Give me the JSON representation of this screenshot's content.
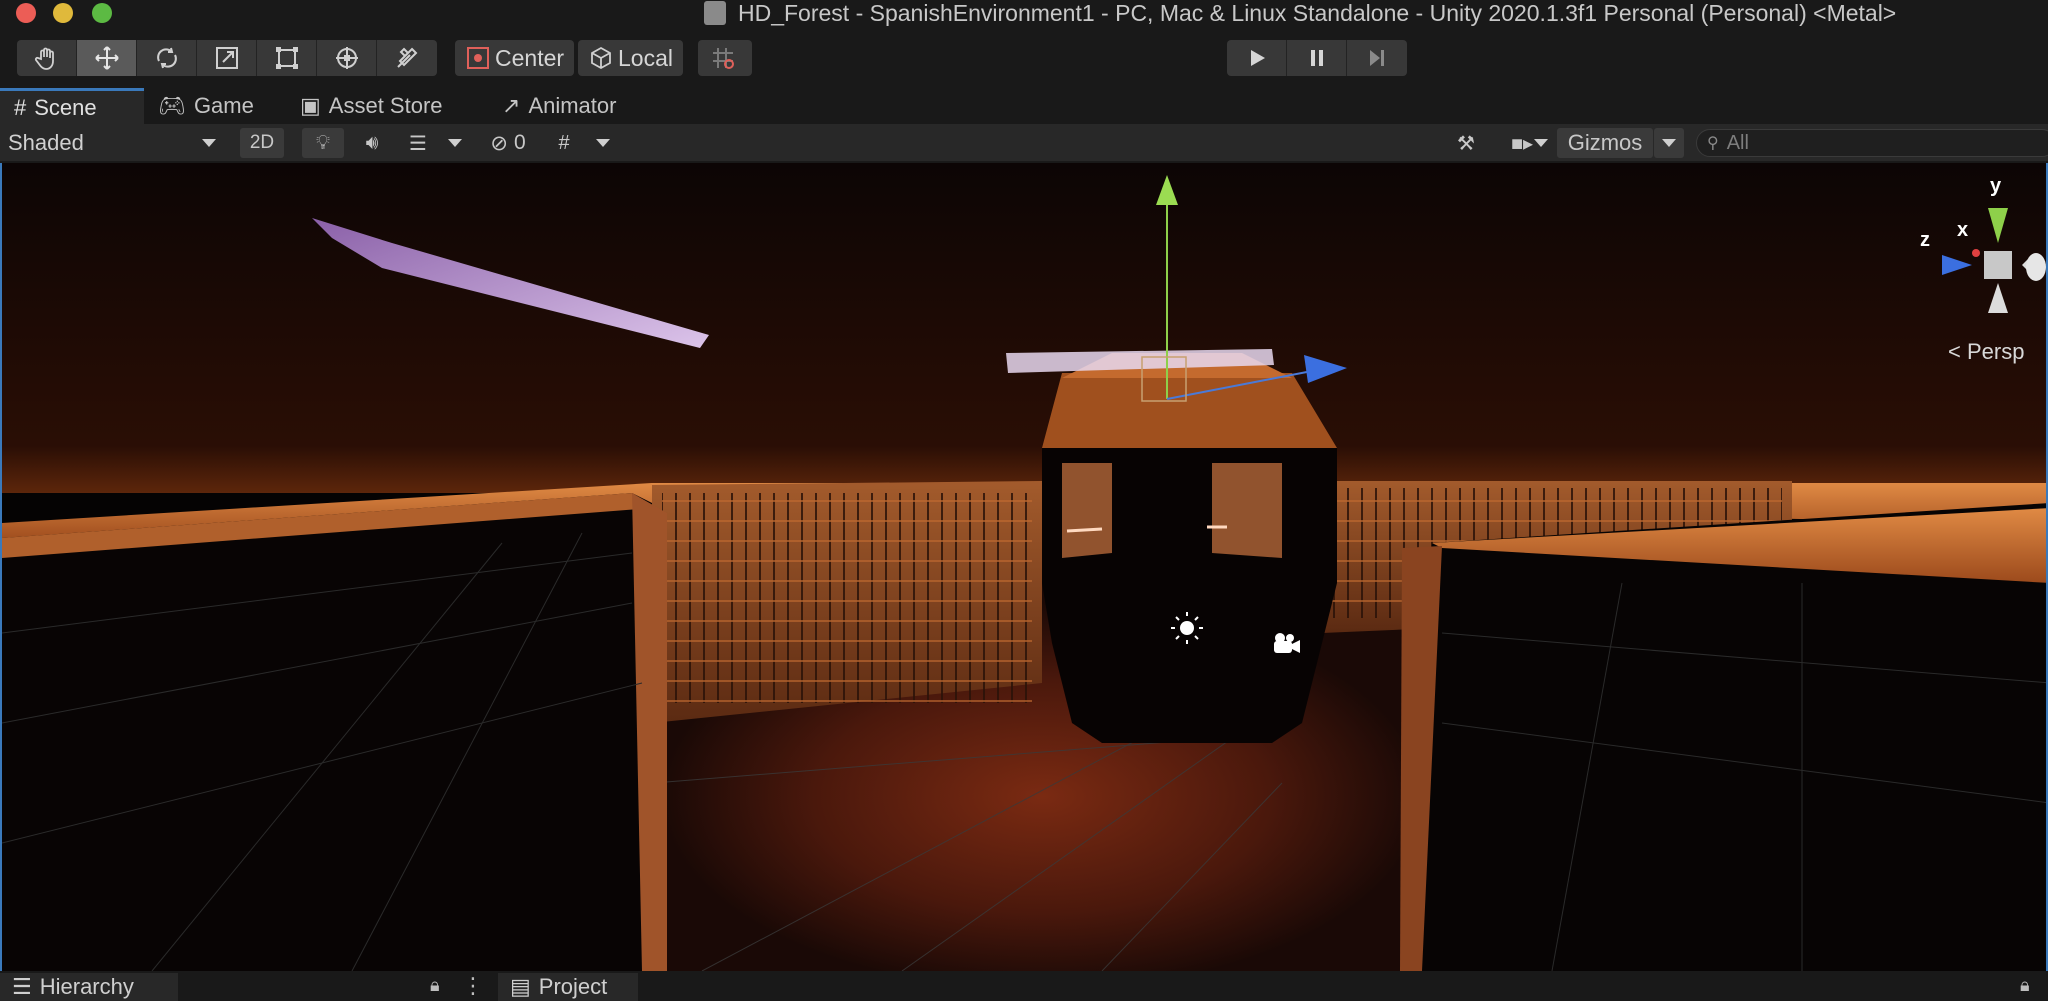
{
  "window": {
    "title": "HD_Forest - SpanishEnvironment1 - PC, Mac & Linux Standalone - Unity 2020.1.3f1 Personal (Personal) <Metal>"
  },
  "toolbar": {
    "tools": [
      "hand-tool-icon",
      "move-tool-icon",
      "rotate-tool-icon",
      "scale-tool-icon",
      "rect-tool-icon",
      "transform-tool-icon",
      "custom-tool-icon"
    ],
    "active_tool": "move-tool-icon",
    "pivot_label": "Center",
    "space_label": "Local",
    "snap_icon": "grid-snap-icon"
  },
  "tabs": [
    {
      "label": "Scene",
      "icon": "grid-icon",
      "active": true
    },
    {
      "label": "Game",
      "icon": "gamepad-icon",
      "active": false
    },
    {
      "label": "Asset Store",
      "icon": "bag-icon",
      "active": false
    },
    {
      "label": "Animator",
      "icon": "animator-icon",
      "active": false
    }
  ],
  "scene_toolbar": {
    "draw_mode": "Shaded",
    "mode_2d": "2D",
    "hidden_count": "0",
    "gizmos_label": "Gizmos",
    "search_placeholder": "All"
  },
  "viewport": {
    "axis_y": "y",
    "axis_x": "x",
    "axis_z": "z",
    "projection": "Persp"
  },
  "bottom_panels": {
    "hierarchy_label": "Hierarchy",
    "project_label": "Project"
  },
  "colors": {
    "accent": "#3a79bb",
    "floor_glow": "#c7672b",
    "sky": "#0d0606"
  }
}
